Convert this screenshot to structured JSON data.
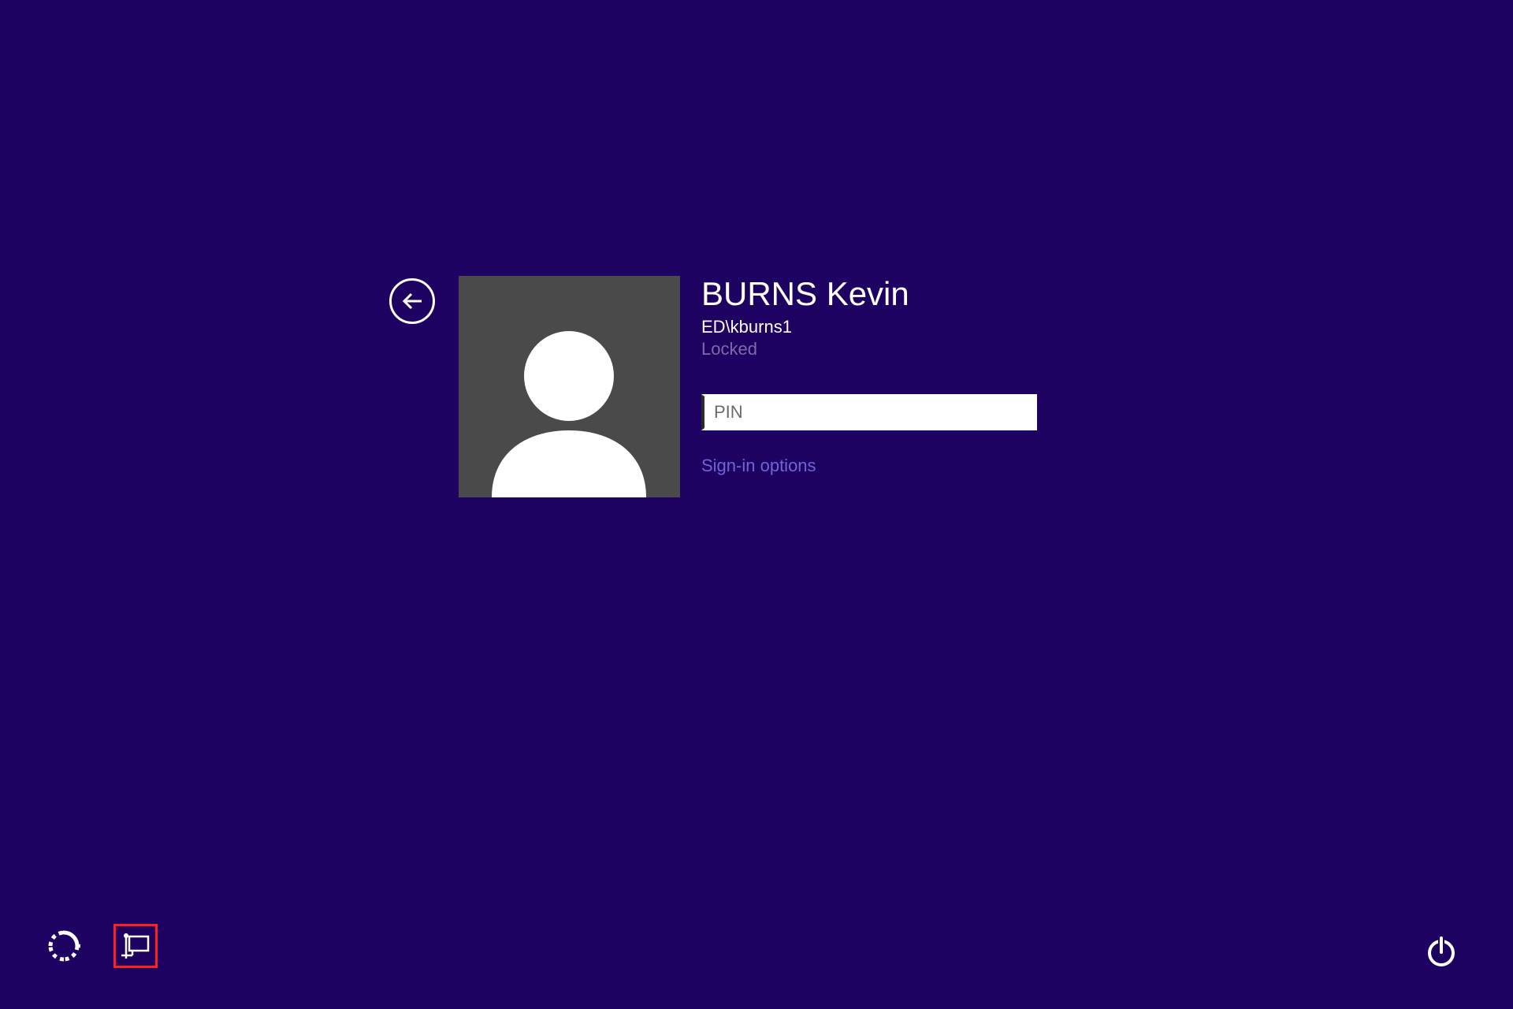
{
  "user": {
    "display_name": "BURNS Kevin",
    "domain_username": "ED\\kburns1",
    "status": "Locked"
  },
  "login": {
    "pin_placeholder": "PIN",
    "signin_options_label": "Sign-in options"
  },
  "icons": {
    "back": "back-arrow",
    "avatar": "user-silhouette",
    "ease_of_access": "ease-of-access",
    "network": "network-ethernet",
    "power": "power"
  }
}
